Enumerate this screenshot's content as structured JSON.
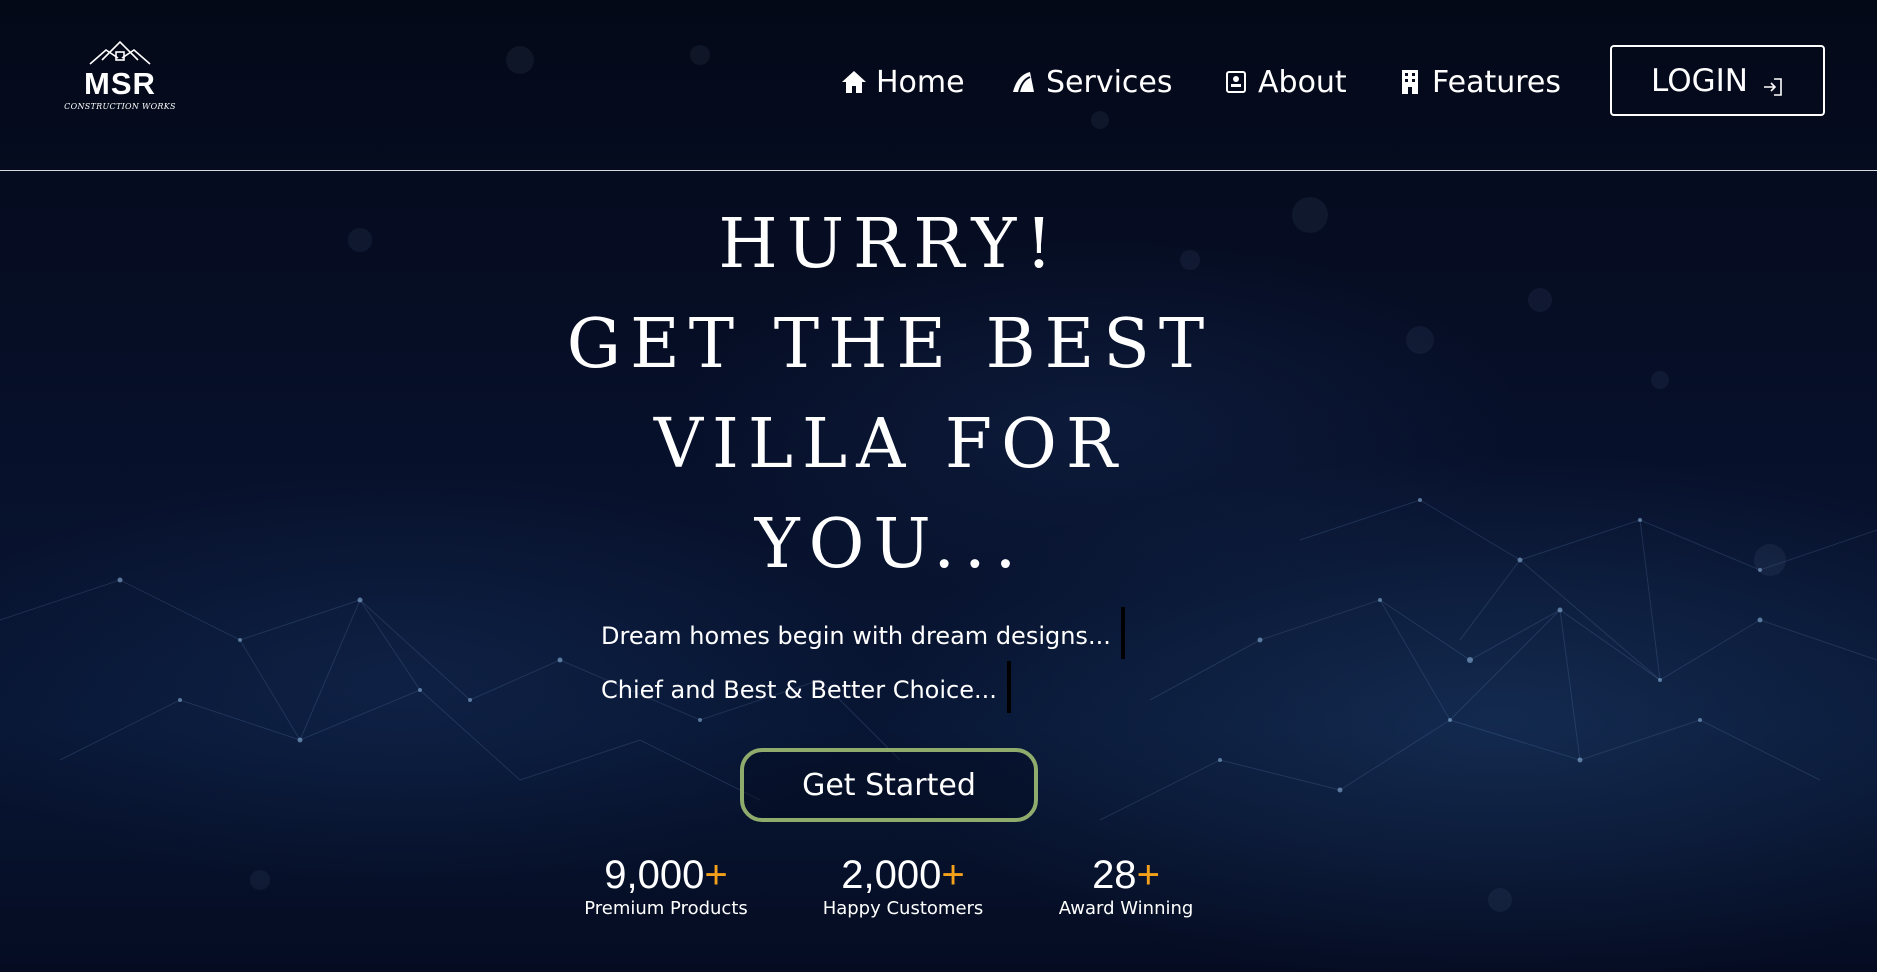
{
  "header": {
    "logo": {
      "text": "MSR",
      "subtext": "CONSTRUCTION WORKS"
    },
    "nav": [
      {
        "label": "Home",
        "icon": "home-icon"
      },
      {
        "label": "Services",
        "icon": "services-icon"
      },
      {
        "label": "About",
        "icon": "contact-card-icon"
      },
      {
        "label": "Features",
        "icon": "building-icon"
      }
    ],
    "login": {
      "label": "LOGIN",
      "icon": "sign-in-icon"
    }
  },
  "hero": {
    "title_lines": [
      "HURRY!",
      "GET THE BEST",
      "VILLA FOR",
      "YOU..."
    ],
    "taglines": [
      "Dream homes begin with dream designs...",
      "Chief and Best & Better Choice..."
    ],
    "cta_label": "Get Started"
  },
  "stats": [
    {
      "number": "9,000",
      "suffix": "+",
      "label": "Premium Products"
    },
    {
      "number": "2,000",
      "suffix": "+",
      "label": "Happy Customers"
    },
    {
      "number": "28",
      "suffix": "+",
      "label": "Award Winning"
    }
  ],
  "colors": {
    "background": "#040a1c",
    "accent_plus": "#f3a01b",
    "cta_border": "#8fac6d",
    "text": "#ffffff"
  }
}
